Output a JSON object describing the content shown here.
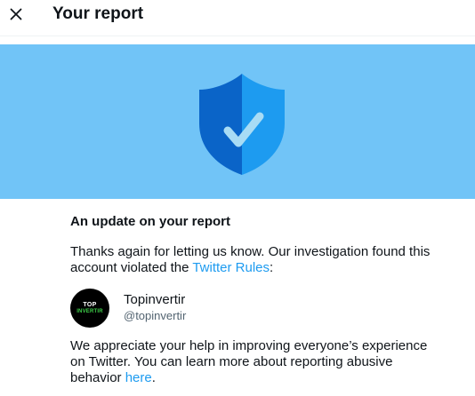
{
  "header": {
    "close_icon": "close-x-icon",
    "title": "Your report"
  },
  "banner": {
    "background_color": "#71c4f7",
    "icon": "shield-check-icon",
    "shield_colors": [
      "#0a64c8",
      "#1d9bf0",
      "#a8dcf5"
    ]
  },
  "main": {
    "update_title": "An update on your report",
    "paragraph1_text": "Thanks again for letting us know. Our investigation found this account violated the ",
    "paragraph1_link": "Twitter Rules",
    "paragraph1_suffix": ":",
    "account": {
      "avatar_line1": "TOP",
      "avatar_line2": "INVERTIR",
      "name": "Topinvertir",
      "handle": "@topinvertir"
    },
    "paragraph2_text": "We appreciate your help in improving everyone’s experience on Twitter. You can learn more about reporting abusive behavior ",
    "paragraph2_link": "here",
    "paragraph2_suffix": "."
  },
  "colors": {
    "link": "#1d9bf0",
    "text": "#0f1419",
    "secondary_text": "#536471"
  }
}
